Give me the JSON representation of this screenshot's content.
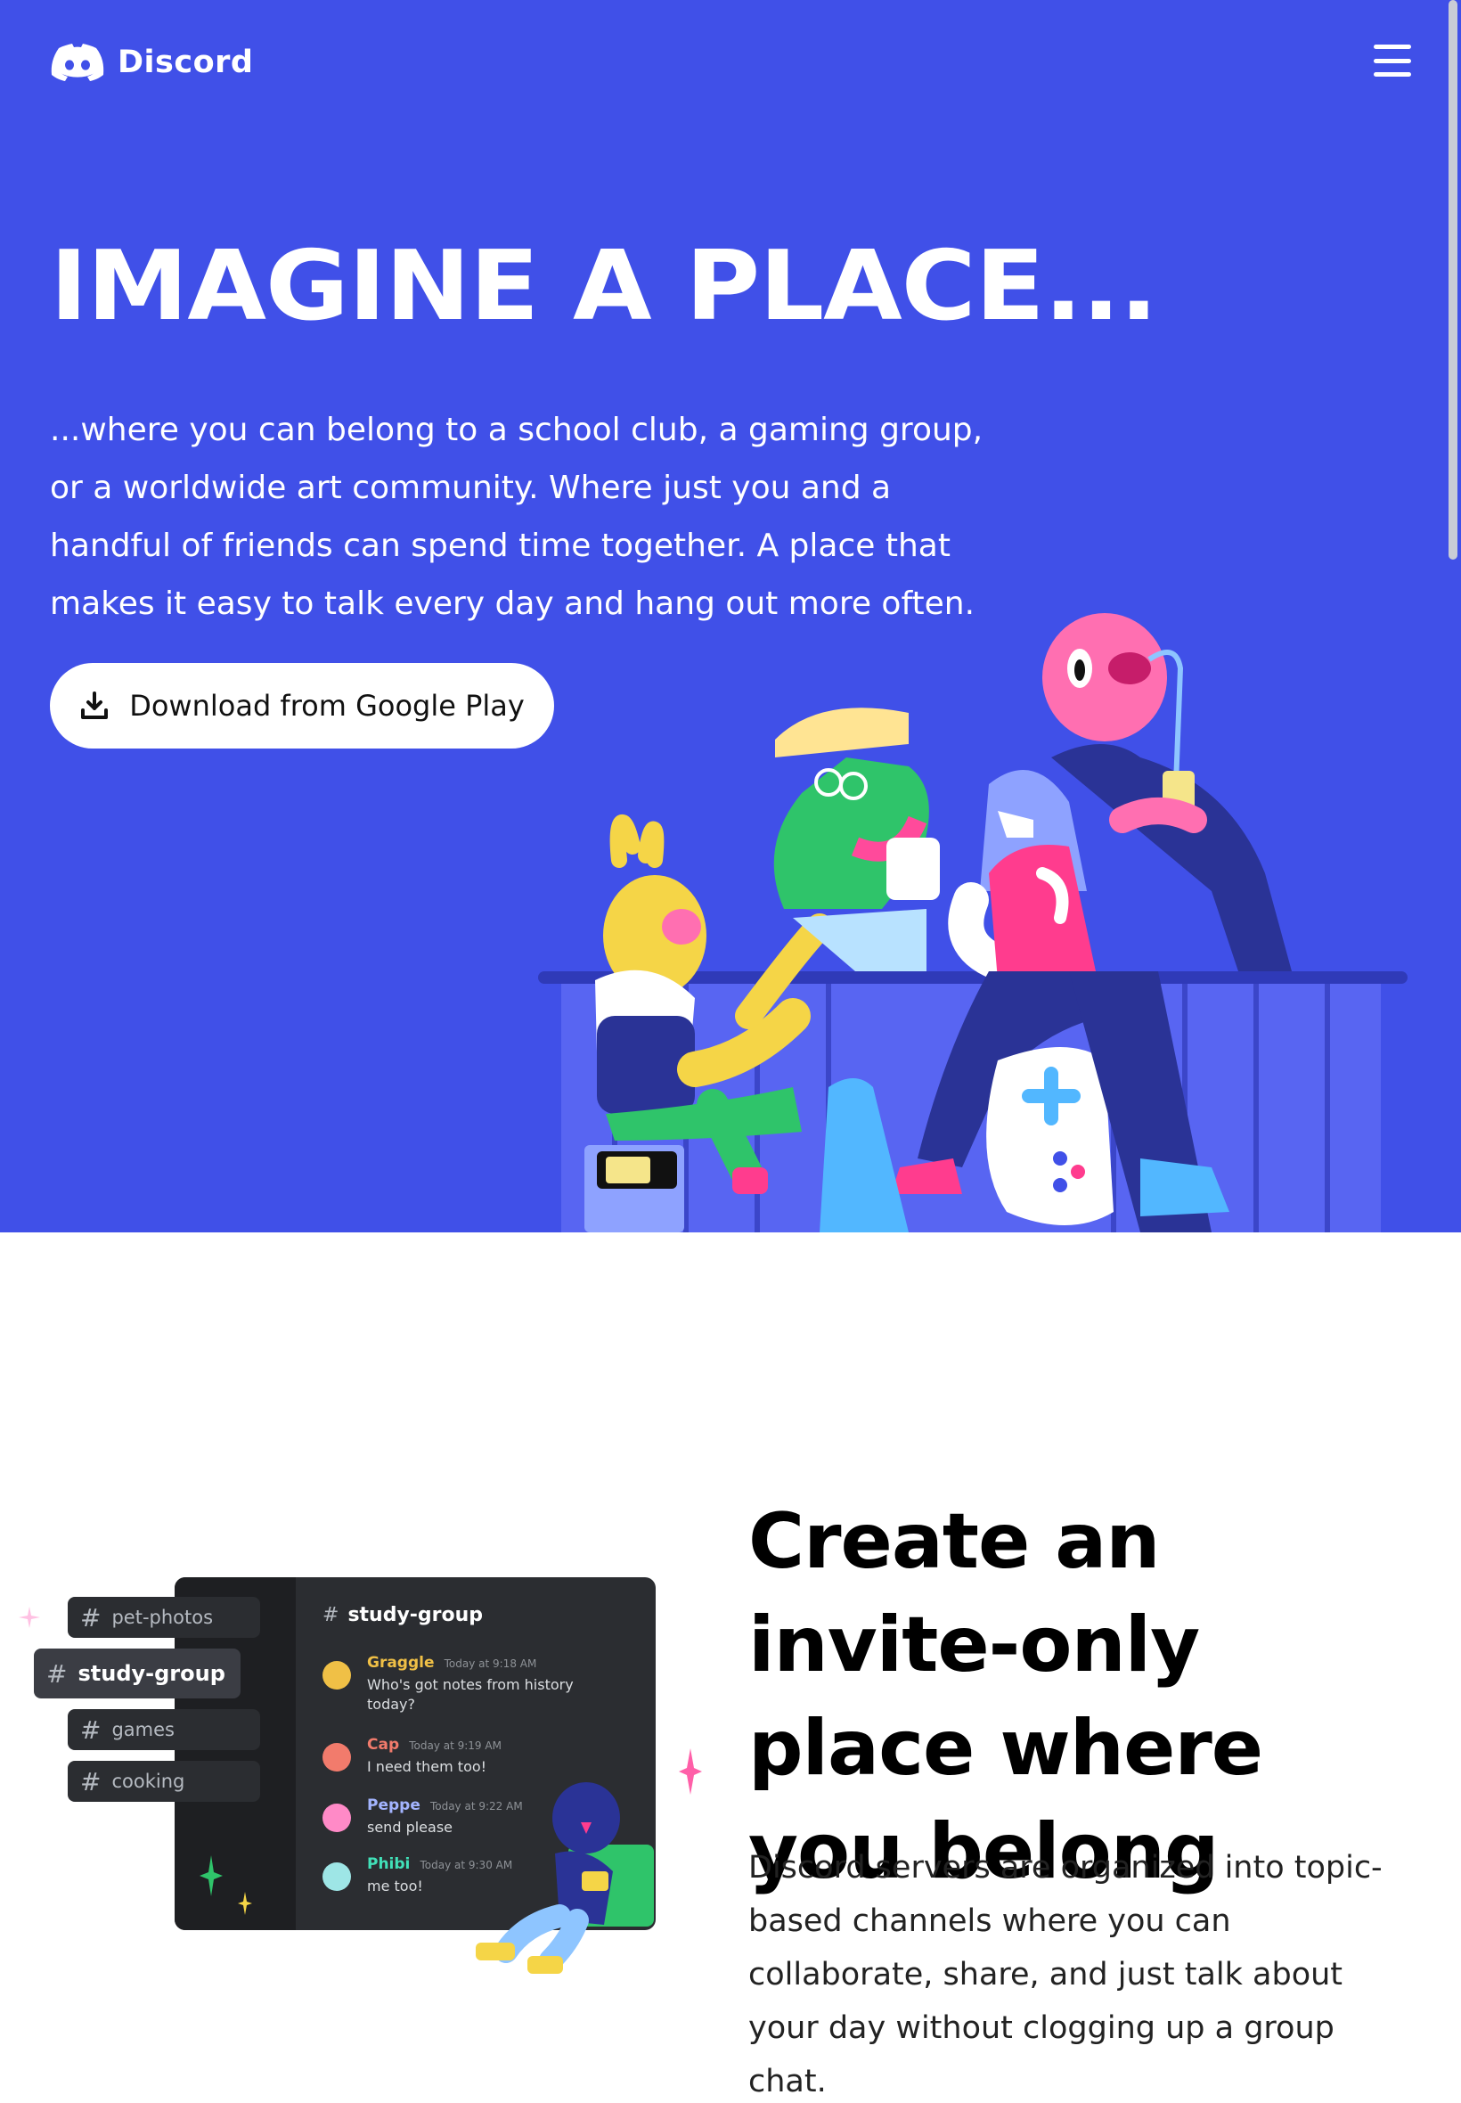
{
  "nav": {
    "brand": "Discord",
    "menu_icon": "hamburger-menu-icon"
  },
  "hero": {
    "title": "IMAGINE A PLACE...",
    "text": "...where you can belong to a school club, a gaming group, or a worldwide art community. Where just you and a handful of friends can spend time together. A place that makes it easy to talk every day and hang out more often.",
    "download_label": "Download from Google Play",
    "download_icon": "download-icon"
  },
  "feature": {
    "title": "Create an invite-only place where you belong",
    "text": "Discord servers are organized into topic-based channels where you can collaborate, share, and just talk about your day without clogging up a group chat.",
    "channels": [
      {
        "name": "pet-photos",
        "active": false
      },
      {
        "name": "study-group",
        "active": true
      },
      {
        "name": "games",
        "active": false
      },
      {
        "name": "cooking",
        "active": false
      }
    ],
    "chat": {
      "channel": "study-group",
      "messages": [
        {
          "author": "Graggle",
          "time": "Today at 9:18 AM",
          "text": "Who's got notes from history today?",
          "color": "#f0c046"
        },
        {
          "author": "Cap",
          "time": "Today at 9:19 AM",
          "text": "I need them too!",
          "color": "#f27b6c"
        },
        {
          "author": "Peppe",
          "time": "Today at 9:22 AM",
          "text": "send please",
          "color": "#a3b4ff"
        },
        {
          "author": "Phibi",
          "time": "Today at 9:30 AM",
          "text": "me too!",
          "color": "#41e0b8"
        }
      ]
    }
  },
  "colors": {
    "blurple": "#4050e8",
    "dark_panel": "#2b2d31",
    "sidebar": "#1e1f22"
  }
}
